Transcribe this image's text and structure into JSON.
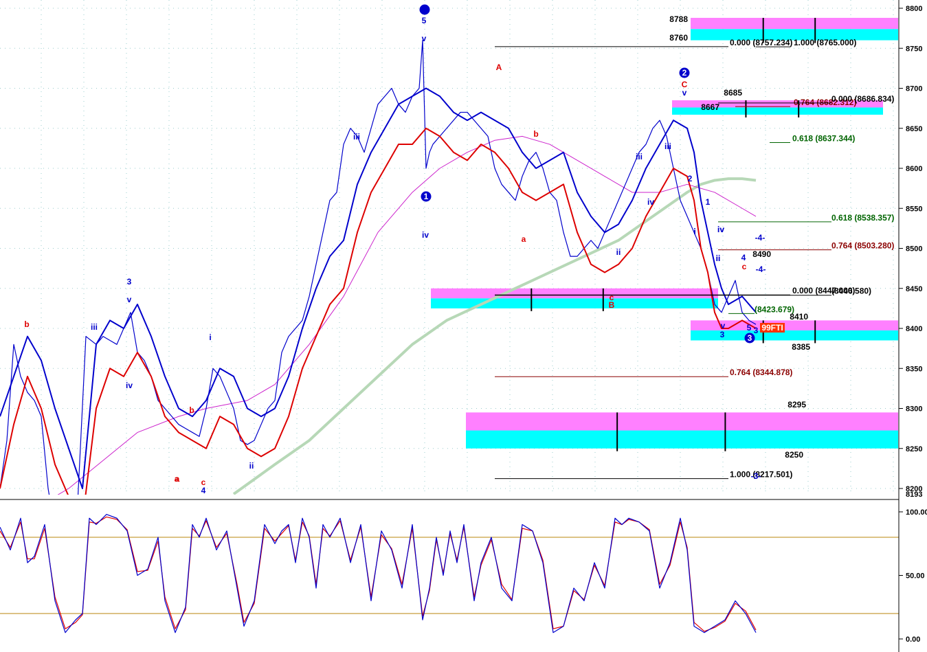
{
  "colors": {
    "price": "#0000cc",
    "upper_band": "#0000cc",
    "lower_band": "#dd0000",
    "ma_fast": "#cc22cc",
    "ma_slow": "#b7d8b7",
    "zone_cyan": "#00ffff",
    "zone_magenta": "#ff80ff",
    "fib_black": "#000000",
    "fib_red": "#8b0000",
    "fib_green": "#006400",
    "osc_band": "#b8860b",
    "wave_blue": "#0000cc",
    "wave_red": "#dd0000"
  },
  "chart_data": [
    {
      "type": "line",
      "panel": "price",
      "ylim": [
        8193,
        8803
      ],
      "y_ticks": [
        "8800",
        "8750",
        "8700",
        "8650",
        "8600",
        "8550",
        "8500",
        "8450",
        "8400",
        "8350",
        "8300",
        "8250",
        "8200"
      ],
      "y_bottom_label": "8193",
      "series": [
        {
          "name": "",
          "role": "price",
          "x": [
            0,
            10,
            20,
            30,
            40,
            50,
            60,
            70,
            80,
            95,
            110,
            125,
            140,
            150,
            160,
            170,
            180,
            190,
            200,
            210,
            220,
            230,
            240,
            250,
            260,
            270,
            280,
            290,
            300,
            310,
            320,
            330,
            340,
            350,
            360,
            370,
            380,
            390,
            400,
            410,
            420,
            430,
            440,
            450,
            460,
            470,
            480,
            490,
            500,
            510,
            520,
            530,
            540,
            550,
            560,
            570,
            580,
            590,
            600,
            610,
            615,
            620,
            625,
            630,
            640,
            650,
            660,
            670,
            680,
            690,
            700,
            710,
            720,
            730,
            740,
            750,
            760,
            770,
            780,
            790,
            800,
            810,
            820,
            830,
            840,
            850,
            860,
            870,
            880,
            890,
            900,
            910,
            920,
            930,
            940,
            950,
            960,
            970,
            980,
            990,
            1000,
            1010,
            1020,
            1030,
            1040,
            1050,
            1060,
            1070,
            1080,
            1090,
            1100
          ],
          "y": [
            8200,
            8260,
            8380,
            8340,
            8320,
            8310,
            8290,
            8200,
            8150,
            8100,
            8130,
            8390,
            8380,
            8390,
            8385,
            8380,
            8400,
            8420,
            8370,
            8360,
            8340,
            8310,
            8300,
            8290,
            8280,
            8275,
            8270,
            8265,
            8300,
            8350,
            8340,
            8320,
            8300,
            8260,
            8255,
            8260,
            8280,
            8300,
            8310,
            8370,
            8390,
            8400,
            8410,
            8440,
            8480,
            8520,
            8560,
            8570,
            8630,
            8650,
            8640,
            8620,
            8650,
            8680,
            8690,
            8700,
            8680,
            8670,
            8690,
            8700,
            8760,
            8600,
            8620,
            8630,
            8640,
            8650,
            8660,
            8670,
            8670,
            8660,
            8650,
            8640,
            8600,
            8580,
            8570,
            8560,
            8590,
            8610,
            8620,
            8600,
            8570,
            8560,
            8520,
            8490,
            8490,
            8500,
            8510,
            8500,
            8520,
            8540,
            8560,
            8580,
            8600,
            8620,
            8630,
            8650,
            8660,
            8640,
            8600,
            8560,
            8540,
            8520,
            8500,
            8470,
            8430,
            8420,
            8440,
            8460,
            8420,
            8410,
            8405
          ]
        },
        {
          "name": "",
          "role": "upper_band",
          "x": [
            0,
            20,
            40,
            60,
            80,
            100,
            120,
            140,
            160,
            180,
            200,
            220,
            240,
            260,
            280,
            300,
            320,
            340,
            360,
            380,
            400,
            420,
            440,
            460,
            480,
            500,
            520,
            540,
            560,
            580,
            600,
            620,
            640,
            660,
            680,
            700,
            720,
            740,
            760,
            780,
            800,
            820,
            840,
            860,
            880,
            900,
            920,
            940,
            960,
            980,
            1000,
            1010,
            1020,
            1030,
            1040,
            1050,
            1060,
            1080,
            1100
          ],
          "y": [
            8290,
            8340,
            8390,
            8360,
            8300,
            8250,
            8200,
            8380,
            8410,
            8400,
            8430,
            8390,
            8340,
            8300,
            8290,
            8310,
            8350,
            8340,
            8300,
            8290,
            8300,
            8340,
            8400,
            8450,
            8490,
            8510,
            8580,
            8620,
            8650,
            8680,
            8690,
            8700,
            8690,
            8670,
            8660,
            8670,
            8660,
            8650,
            8620,
            8600,
            8610,
            8620,
            8570,
            8540,
            8520,
            8530,
            8560,
            8600,
            8630,
            8660,
            8650,
            8620,
            8560,
            8520,
            8480,
            8450,
            8430,
            8440,
            8420
          ]
        },
        {
          "name": "",
          "role": "lower_band",
          "x": [
            0,
            20,
            40,
            60,
            80,
            100,
            120,
            140,
            160,
            180,
            200,
            220,
            240,
            260,
            280,
            300,
            320,
            340,
            360,
            380,
            400,
            420,
            440,
            460,
            480,
            500,
            520,
            540,
            560,
            580,
            600,
            620,
            640,
            660,
            680,
            700,
            720,
            740,
            760,
            780,
            800,
            820,
            840,
            860,
            880,
            900,
            920,
            940,
            960,
            980,
            1000,
            1010,
            1020,
            1030,
            1040,
            1050,
            1060,
            1080,
            1100
          ],
          "y": [
            8200,
            8280,
            8340,
            8300,
            8230,
            8190,
            8160,
            8300,
            8350,
            8340,
            8370,
            8340,
            8290,
            8270,
            8260,
            8250,
            8290,
            8280,
            8250,
            8240,
            8250,
            8290,
            8350,
            8390,
            8430,
            8450,
            8520,
            8570,
            8600,
            8630,
            8630,
            8650,
            8640,
            8620,
            8610,
            8630,
            8620,
            8600,
            8570,
            8560,
            8570,
            8580,
            8520,
            8480,
            8470,
            8480,
            8500,
            8540,
            8570,
            8600,
            8590,
            8560,
            8500,
            8470,
            8420,
            8400,
            8400,
            8410,
            8400
          ]
        },
        {
          "name": "",
          "role": "ma_fast",
          "x": [
            0,
            100,
            200,
            260,
            300,
            360,
            400,
            450,
            500,
            550,
            600,
            640,
            680,
            720,
            760,
            800,
            840,
            880,
            920,
            960,
            1000,
            1040,
            1080,
            1100
          ],
          "y": [
            8150,
            8200,
            8270,
            8290,
            8300,
            8310,
            8330,
            8380,
            8440,
            8520,
            8570,
            8600,
            8620,
            8635,
            8640,
            8630,
            8610,
            8590,
            8570,
            8570,
            8580,
            8570,
            8550,
            8540
          ]
        },
        {
          "name": "",
          "role": "ma_slow",
          "x": [
            340,
            400,
            450,
            500,
            550,
            600,
            650,
            700,
            750,
            800,
            850,
            900,
            950,
            1000,
            1020,
            1040,
            1060,
            1080,
            1100
          ],
          "y": [
            8193,
            8230,
            8260,
            8300,
            8340,
            8380,
            8410,
            8430,
            8450,
            8470,
            8490,
            8510,
            8540,
            8570,
            8580,
            8585,
            8587,
            8587,
            8585
          ]
        }
      ],
      "zones": [
        {
          "x0": 1005,
          "x1": 1307,
          "top": 8788,
          "bottom": 8760
        },
        {
          "x0": 978,
          "x1": 1285,
          "top": 8685,
          "bottom": 8667
        },
        {
          "x0": 627,
          "x1": 1045,
          "top": 8450,
          "bottom": 8425
        },
        {
          "x0": 1005,
          "x1": 1307,
          "top": 8410,
          "bottom": 8385
        },
        {
          "x0": 678,
          "x1": 1307,
          "top": 8295,
          "bottom": 8250
        }
      ],
      "zone_labels": [
        "8788",
        "8760",
        "8685",
        "8667",
        "8410",
        "8385",
        "8295",
        "8250",
        "8490"
      ],
      "fib_lines": [
        {
          "text": "0.000 (8757.234)",
          "value": 8757.234,
          "color": "fib_black"
        },
        {
          "text": "1.000 (8765.000)",
          "value": 8757,
          "color": "fib_black"
        },
        {
          "text": "0.764 (8682.312)",
          "value": 8682.312,
          "color": "fib_red"
        },
        {
          "text": "0.000 (8686.834)",
          "value": 8686.834,
          "color": "fib_black"
        },
        {
          "text": "0.618 (8637.344)",
          "value": 8637.344,
          "color": "fib_green"
        },
        {
          "text": "0.618 (8538.357)",
          "value": 8538.357,
          "color": "fib_green"
        },
        {
          "text": "0.764 (8503.280)",
          "value": 8503.28,
          "color": "fib_red"
        },
        {
          "text": "0.000 (8447.000)",
          "value": 8447,
          "color": "fib_black"
        },
        {
          "text": "(8446.580)",
          "value": 8446.58,
          "color": "fib_black"
        },
        {
          "text": "(8423.679)",
          "value": 8423.679,
          "color": "fib_green"
        },
        {
          "text": "0.764 (8344.878)",
          "value": 8344.878,
          "color": "fib_red"
        },
        {
          "text": "1.000 (8217.501)",
          "value": 8217.501,
          "color": "fib_black"
        }
      ],
      "annotations": [
        "5",
        "v",
        "A",
        "2",
        "C",
        "v",
        "b",
        "iii",
        "iv",
        "1",
        "iv",
        "a",
        "iii",
        "ii",
        "c",
        "B",
        "i",
        "ii",
        "iii",
        "iv",
        "1",
        "2",
        "i",
        "ii",
        "iv",
        "4",
        "c",
        "3",
        "v",
        "3",
        "5",
        "3",
        "-4-",
        "-4-",
        "-3-",
        "b",
        "a",
        "iii",
        "3",
        "v",
        "iv",
        "b",
        "c",
        "a",
        "4",
        "i",
        "ii",
        "99FTI"
      ]
    },
    {
      "type": "line",
      "panel": "oscillator",
      "ylim": [
        0,
        100
      ],
      "y_ticks": [
        "100.00",
        "50.00",
        "0.00"
      ],
      "bands": [
        80,
        20
      ],
      "series": [
        {
          "name": "",
          "role": "osc_k",
          "x": [
            0,
            15,
            30,
            40,
            50,
            65,
            80,
            95,
            110,
            120,
            130,
            140,
            155,
            170,
            185,
            200,
            215,
            230,
            240,
            255,
            270,
            280,
            290,
            300,
            315,
            330,
            345,
            355,
            370,
            385,
            400,
            410,
            420,
            430,
            440,
            450,
            460,
            470,
            480,
            495,
            510,
            525,
            540,
            555,
            570,
            585,
            600,
            615,
            625,
            635,
            645,
            655,
            665,
            675,
            690,
            700,
            715,
            730,
            745,
            760,
            775,
            790,
            805,
            820,
            835,
            850,
            865,
            880,
            895,
            905,
            915,
            930,
            945,
            960,
            975,
            990,
            1000,
            1010,
            1025,
            1040,
            1055,
            1070,
            1085,
            1100
          ],
          "y": [
            88,
            70,
            95,
            60,
            65,
            90,
            30,
            5,
            15,
            20,
            95,
            90,
            98,
            95,
            85,
            50,
            55,
            80,
            30,
            5,
            25,
            90,
            80,
            95,
            70,
            85,
            40,
            10,
            30,
            90,
            75,
            85,
            90,
            60,
            95,
            80,
            40,
            90,
            80,
            95,
            60,
            90,
            30,
            85,
            70,
            40,
            90,
            15,
            40,
            80,
            50,
            85,
            60,
            90,
            30,
            60,
            80,
            40,
            30,
            90,
            85,
            60,
            5,
            10,
            40,
            30,
            60,
            40,
            95,
            90,
            95,
            92,
            85,
            40,
            60,
            95,
            70,
            10,
            5,
            10,
            15,
            30,
            20,
            5
          ]
        },
        {
          "name": "",
          "role": "osc_d",
          "x": [
            0,
            15,
            30,
            40,
            50,
            65,
            80,
            95,
            110,
            120,
            130,
            140,
            155,
            170,
            185,
            200,
            215,
            230,
            240,
            255,
            270,
            280,
            290,
            300,
            315,
            330,
            345,
            355,
            370,
            385,
            400,
            410,
            420,
            430,
            440,
            450,
            460,
            470,
            480,
            495,
            510,
            525,
            540,
            555,
            570,
            585,
            600,
            615,
            625,
            635,
            645,
            655,
            665,
            675,
            690,
            700,
            715,
            730,
            745,
            760,
            775,
            790,
            805,
            820,
            835,
            850,
            865,
            880,
            895,
            905,
            915,
            930,
            945,
            960,
            975,
            990,
            1000,
            1010,
            1025,
            1040,
            1055,
            1070,
            1085,
            1100
          ],
          "y": [
            85,
            72,
            92,
            63,
            63,
            87,
            33,
            8,
            13,
            19,
            92,
            91,
            96,
            94,
            86,
            53,
            54,
            77,
            33,
            8,
            23,
            87,
            81,
            93,
            72,
            83,
            43,
            13,
            28,
            87,
            77,
            83,
            89,
            62,
            92,
            81,
            43,
            87,
            81,
            93,
            62,
            88,
            33,
            82,
            71,
            43,
            87,
            18,
            38,
            78,
            52,
            83,
            62,
            88,
            33,
            58,
            78,
            43,
            31,
            87,
            85,
            62,
            8,
            10,
            38,
            31,
            58,
            42,
            92,
            90,
            94,
            92,
            86,
            43,
            58,
            92,
            72,
            13,
            6,
            9,
            14,
            28,
            22,
            7
          ]
        }
      ]
    }
  ]
}
